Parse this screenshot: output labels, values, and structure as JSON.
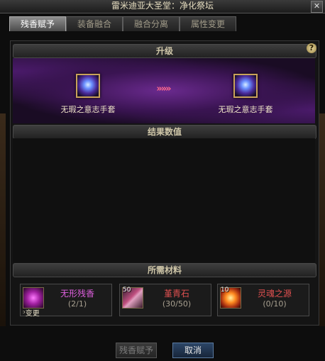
{
  "window": {
    "title": "雷米迪亚大圣堂：净化祭坛",
    "close_icon": "close-icon"
  },
  "tabs": [
    {
      "label": "残香赋予",
      "active": true
    },
    {
      "label": "装备融合",
      "active": false
    },
    {
      "label": "融合分离",
      "active": false
    },
    {
      "label": "属性变更",
      "active": false
    }
  ],
  "upgrade": {
    "header": "升级",
    "help": "?",
    "source_item": "无瑕之意志手套",
    "arrows": "»»»",
    "target_item": "无瑕之意志手套"
  },
  "result": {
    "header": "结果数值"
  },
  "materials": {
    "header": "所需材料",
    "items": [
      {
        "name": "无形残香",
        "count": "(2/1)",
        "color": "#e060e0",
        "badge": "",
        "sub_label": "ᵓ变更"
      },
      {
        "name": "堇青石",
        "count": "(30/50)",
        "color": "#e05050",
        "badge": "50",
        "sub_label": ""
      },
      {
        "name": "灵魂之源",
        "count": "(0/10)",
        "color": "#e05050",
        "badge": "10",
        "sub_label": ""
      }
    ]
  },
  "buttons": {
    "confirm": "残香赋予",
    "cancel": "取消"
  }
}
